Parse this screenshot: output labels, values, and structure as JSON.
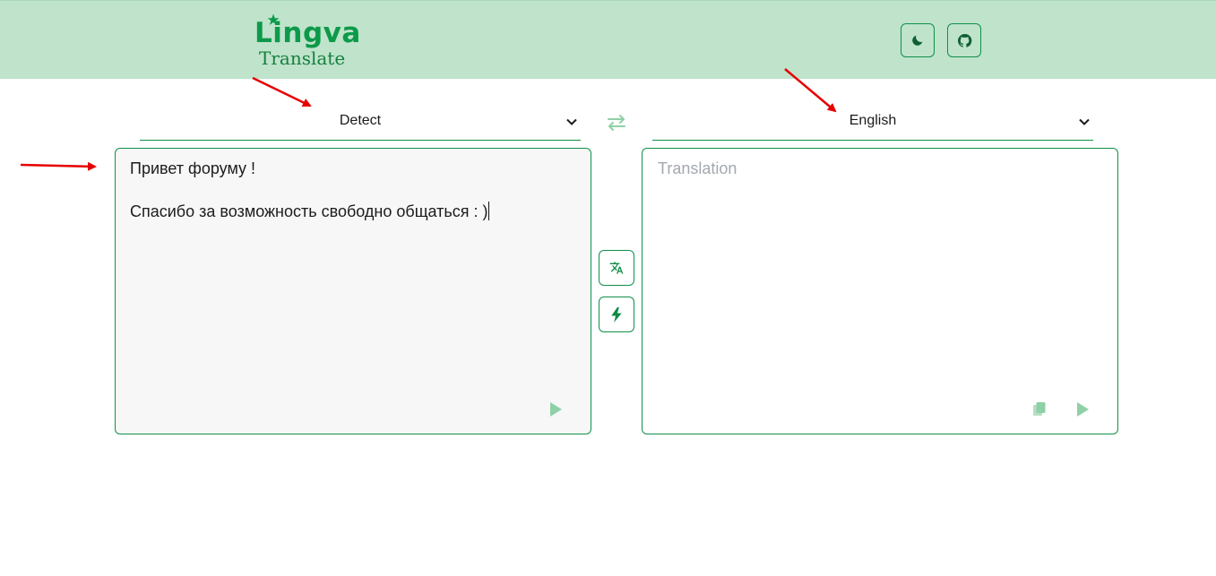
{
  "header": {
    "logo_main": "Lingva",
    "logo_sub": "Translate",
    "theme_toggle_icon": "moon-icon",
    "github_icon": "github-icon"
  },
  "source": {
    "language": "Detect",
    "text": "Привет форуму !\n\nСпасибо за возможность свободно общаться : )",
    "play_icon": "play-icon"
  },
  "target": {
    "language": "English",
    "placeholder": "Translation",
    "copy_icon": "copy-icon",
    "play_icon": "play-icon"
  },
  "actions": {
    "swap_icon": "swap-icon",
    "translate_icon": "translate-icon",
    "auto_translate_icon": "lightning-icon"
  },
  "colors": {
    "header_bg": "#bfe3cb",
    "accent": "#10904a",
    "annotation_arrow": "#e60000"
  }
}
